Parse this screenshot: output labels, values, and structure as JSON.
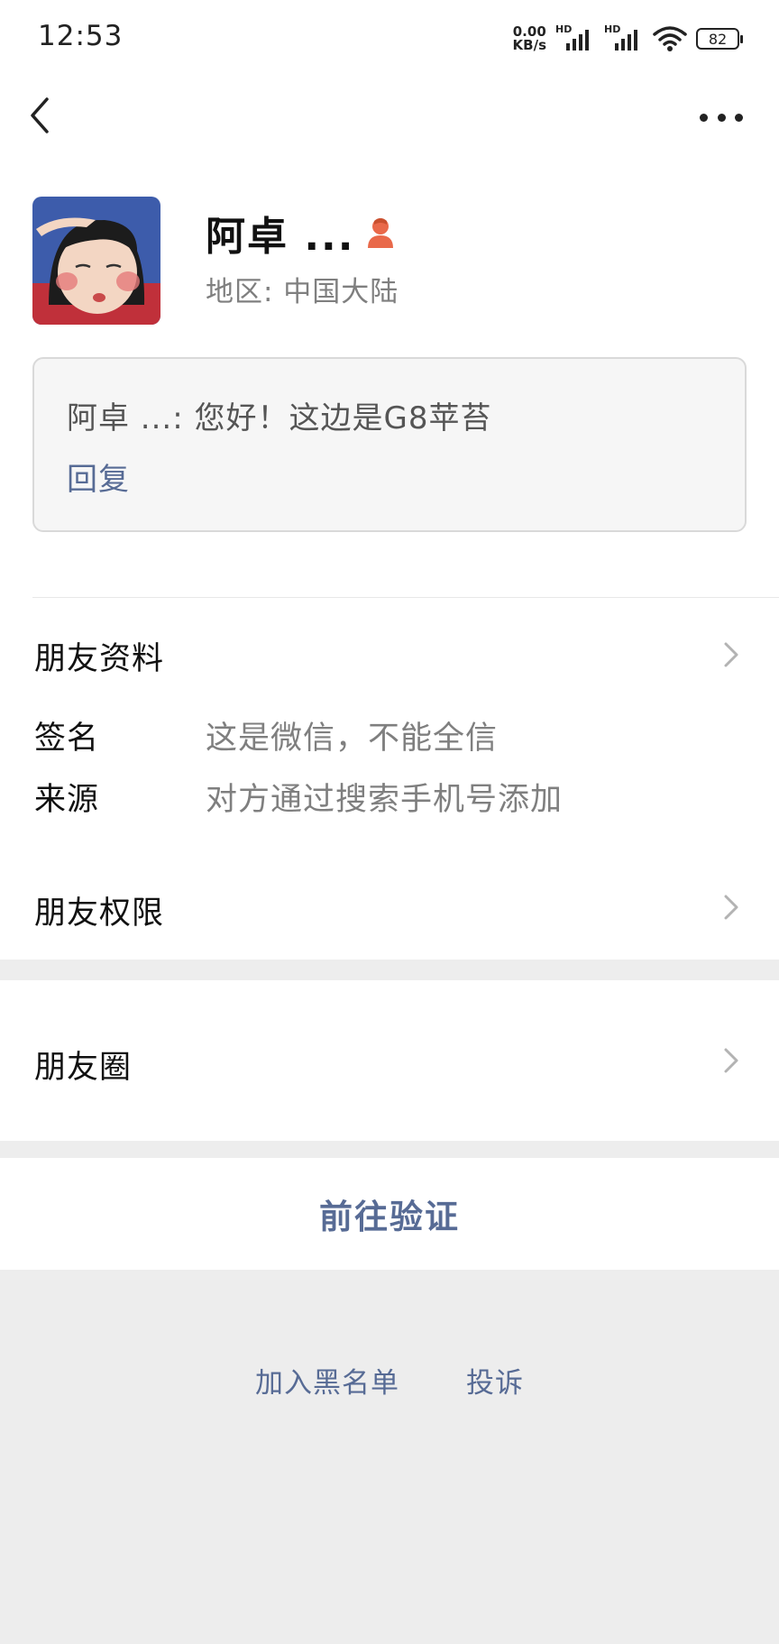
{
  "status_bar": {
    "time": "12:53",
    "net_speed_value": "0.00",
    "net_speed_unit": "KB/s",
    "sim1_label": "HD",
    "sim2_label": "HD",
    "battery": "82"
  },
  "nav": {
    "back_icon": "chevron-left-icon",
    "more_icon": "more-dots-icon"
  },
  "profile": {
    "name": "阿卓 ...",
    "gender_icon": "female-user-icon",
    "gender_color": "#e9694a",
    "region": "地区:  中国大陆"
  },
  "message": {
    "text": "阿卓 ...: 您好！这边是G8苹苔",
    "reply_label": "回复"
  },
  "friend_info": {
    "title": "朋友资料",
    "signature_label": "签名",
    "signature_value": "这是微信，不能全信",
    "source_label": "来源",
    "source_value": "对方通过搜索手机号添加"
  },
  "permissions": {
    "title": "朋友权限"
  },
  "moments": {
    "title": "朋友圈"
  },
  "actions": {
    "verify_label": "前往验证",
    "blacklist_label": "加入黑名单",
    "report_label": "投诉"
  },
  "colors": {
    "link": "#576b95",
    "background": "#ededed",
    "card": "#ffffff"
  }
}
